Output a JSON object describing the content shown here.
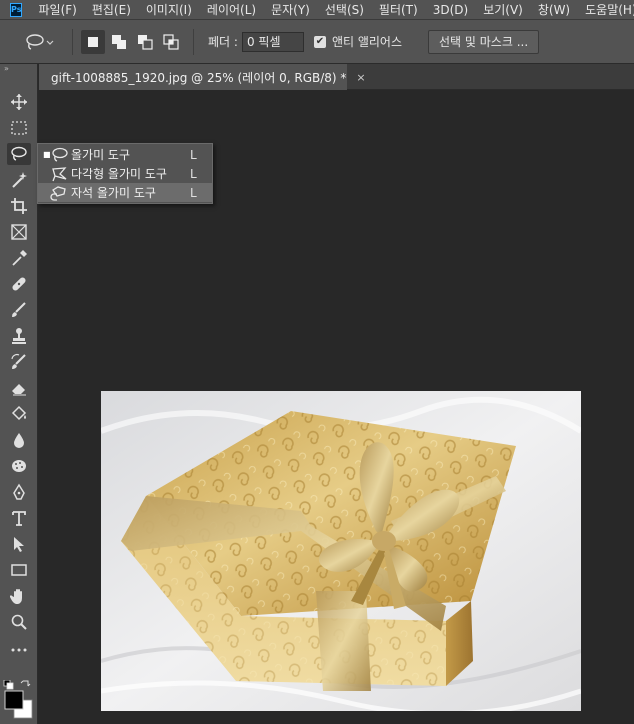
{
  "app": {
    "logo_text": "Ps"
  },
  "menubar": {
    "items": [
      "파일(F)",
      "편집(E)",
      "이미지(I)",
      "레이어(L)",
      "문자(Y)",
      "선택(S)",
      "필터(T)",
      "3D(D)",
      "보기(V)",
      "창(W)",
      "도움말(H)"
    ]
  },
  "options": {
    "feather_label": "페더 :",
    "feather_value": "0 픽셀",
    "anti_alias_checked": true,
    "anti_alias_label": "앤티 앨리어스",
    "select_mask_label": "선택 및 마스크 ..."
  },
  "document": {
    "tab_title": "gift-1008885_1920.jpg @ 25% (레이어 0, RGB/8) *",
    "close_glyph": "×"
  },
  "toolbar": {
    "collapse_glyph": "»"
  },
  "flyout": {
    "items": [
      {
        "label": "올가미 도구",
        "shortcut": "L",
        "selected": true,
        "icon": "lasso-icon"
      },
      {
        "label": "다각형 올가미 도구",
        "shortcut": "L",
        "selected": false,
        "icon": "polygonal-lasso-icon"
      },
      {
        "label": "자석 올가미 도구",
        "shortcut": "L",
        "selected": false,
        "icon": "magnetic-lasso-icon"
      }
    ],
    "bullet": "■"
  },
  "colors": {
    "foreground": "#000000",
    "background": "#ffffff",
    "ui_panel": "#535353",
    "canvas_bg": "#282828"
  }
}
